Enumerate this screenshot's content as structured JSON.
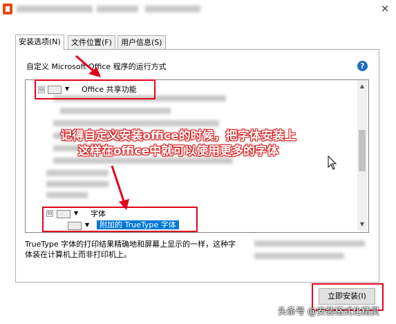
{
  "window": {
    "title": "",
    "close_glyph": "×"
  },
  "tabs": [
    {
      "label": "安装选项(N)",
      "active": true
    },
    {
      "label": "文件位置(F)",
      "active": false
    },
    {
      "label": "用户信息(S)",
      "active": false
    }
  ],
  "description": "自定义 Microsoft Office 程序的运行方式",
  "help_glyph": "?",
  "tree": {
    "root": {
      "expander": "⊟",
      "label": "Office 共享功能"
    },
    "font_node": {
      "expander": "⊟",
      "label": "字体"
    },
    "font_child": {
      "label": "附加的 TrueType 字体",
      "selected": true
    }
  },
  "info_text": [
    "TrueType 字体的打印结果精确地和屏幕上显示的一样，这种字",
    "体装在计算机上而非打印机上。"
  ],
  "install_button": "立即安装(I)",
  "annotation": [
    "记得自定义安装office的时候，把字体安装上",
    "这样在office中就可以使用更多的字体"
  ],
  "watermark": "头条号 @安装格式化精灵",
  "colors": {
    "annotation_red": "#e3001b",
    "selection_blue": "#0078d7",
    "help_blue": "#1e6cc8"
  },
  "icons": [
    "office-app-icon",
    "close-icon",
    "help-icon",
    "drive-icon",
    "dropdown-arrow-icon",
    "expander-icon",
    "mouse-cursor-icon",
    "red-arrow-icon"
  ]
}
